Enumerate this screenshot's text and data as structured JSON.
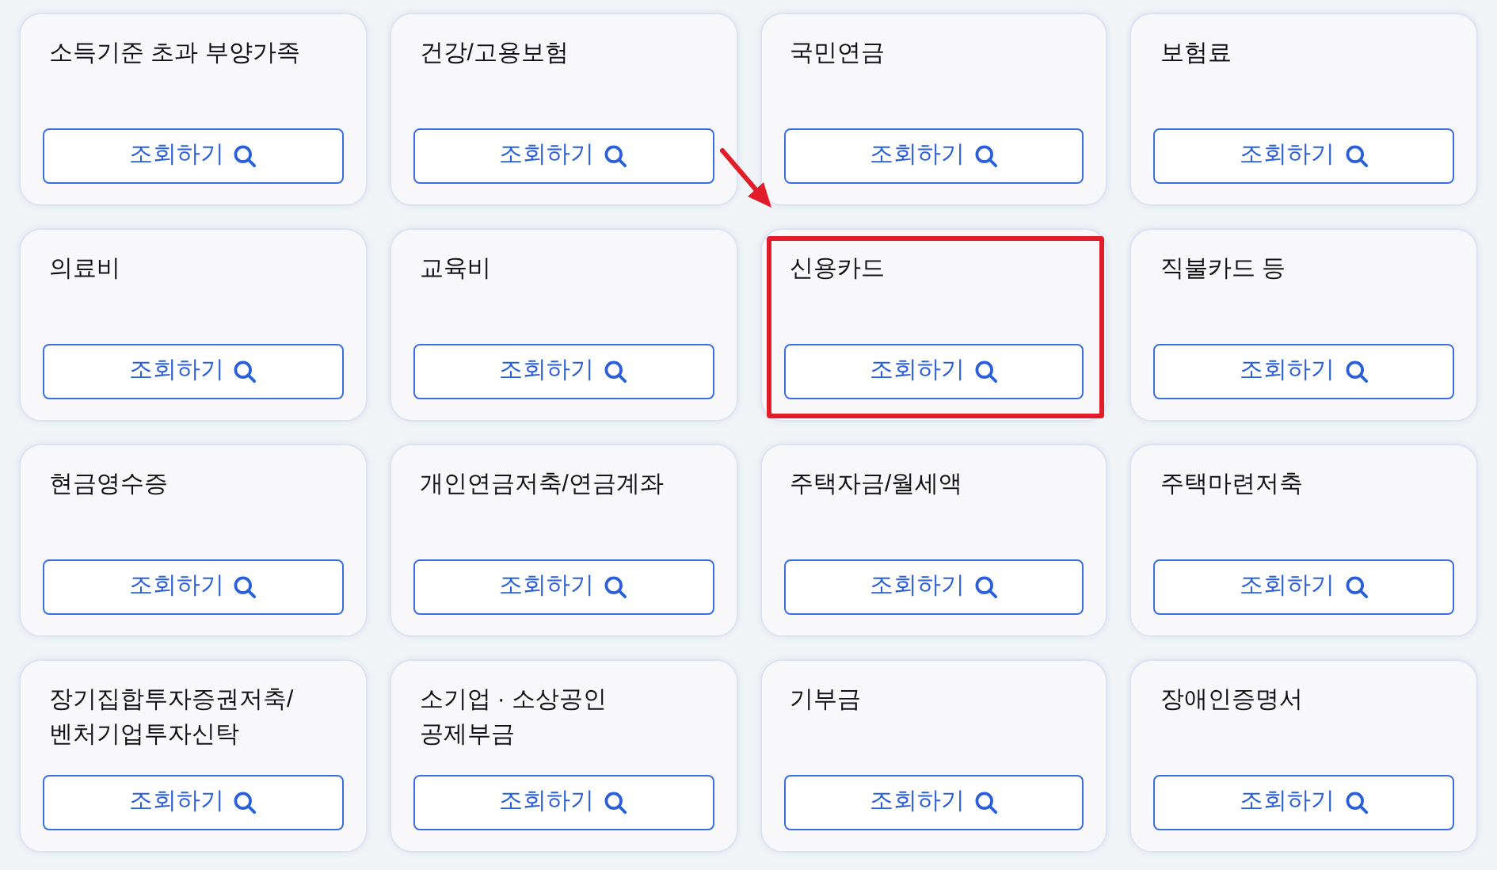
{
  "cards": [
    {
      "title": "소득기준 초과 부양가족",
      "button": "조회하기",
      "highlighted": false
    },
    {
      "title": "건강/고용보험",
      "button": "조회하기",
      "highlighted": false
    },
    {
      "title": "국민연금",
      "button": "조회하기",
      "highlighted": false
    },
    {
      "title": "보험료",
      "button": "조회하기",
      "highlighted": false
    },
    {
      "title": "의료비",
      "button": "조회하기",
      "highlighted": false
    },
    {
      "title": "교육비",
      "button": "조회하기",
      "highlighted": false
    },
    {
      "title": "신용카드",
      "button": "조회하기",
      "highlighted": true
    },
    {
      "title": "직불카드 등",
      "button": "조회하기",
      "highlighted": false
    },
    {
      "title": "현금영수증",
      "button": "조회하기",
      "highlighted": false
    },
    {
      "title": "개인연금저축/연금계좌",
      "button": "조회하기",
      "highlighted": false
    },
    {
      "title": "주택자금/월세액",
      "button": "조회하기",
      "highlighted": false
    },
    {
      "title": "주택마련저축",
      "button": "조회하기",
      "highlighted": false
    },
    {
      "title": "장기집합투자증권저축/\n벤처기업투자신탁",
      "button": "조회하기",
      "highlighted": false
    },
    {
      "title": "소기업 · 소상공인\n공제부금",
      "button": "조회하기",
      "highlighted": false
    },
    {
      "title": "기부금",
      "button": "조회하기",
      "highlighted": false
    },
    {
      "title": "장애인증명서",
      "button": "조회하기",
      "highlighted": false
    }
  ]
}
